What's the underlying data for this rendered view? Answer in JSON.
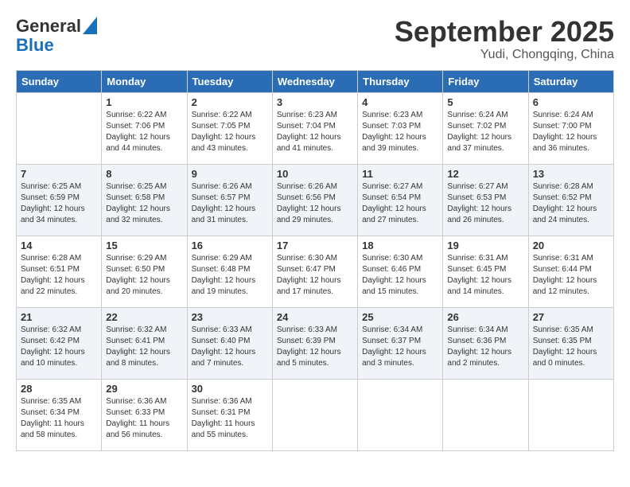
{
  "header": {
    "logo_line1": "General",
    "logo_line2": "Blue",
    "month": "September 2025",
    "location": "Yudi, Chongqing, China"
  },
  "weekdays": [
    "Sunday",
    "Monday",
    "Tuesday",
    "Wednesday",
    "Thursday",
    "Friday",
    "Saturday"
  ],
  "weeks": [
    [
      {
        "day": "",
        "sunrise": "",
        "sunset": "",
        "daylight": ""
      },
      {
        "day": "1",
        "sunrise": "6:22 AM",
        "sunset": "7:06 PM",
        "daylight": "12 hours and 44 minutes."
      },
      {
        "day": "2",
        "sunrise": "6:22 AM",
        "sunset": "7:05 PM",
        "daylight": "12 hours and 43 minutes."
      },
      {
        "day": "3",
        "sunrise": "6:23 AM",
        "sunset": "7:04 PM",
        "daylight": "12 hours and 41 minutes."
      },
      {
        "day": "4",
        "sunrise": "6:23 AM",
        "sunset": "7:03 PM",
        "daylight": "12 hours and 39 minutes."
      },
      {
        "day": "5",
        "sunrise": "6:24 AM",
        "sunset": "7:02 PM",
        "daylight": "12 hours and 37 minutes."
      },
      {
        "day": "6",
        "sunrise": "6:24 AM",
        "sunset": "7:00 PM",
        "daylight": "12 hours and 36 minutes."
      }
    ],
    [
      {
        "day": "7",
        "sunrise": "6:25 AM",
        "sunset": "6:59 PM",
        "daylight": "12 hours and 34 minutes."
      },
      {
        "day": "8",
        "sunrise": "6:25 AM",
        "sunset": "6:58 PM",
        "daylight": "12 hours and 32 minutes."
      },
      {
        "day": "9",
        "sunrise": "6:26 AM",
        "sunset": "6:57 PM",
        "daylight": "12 hours and 31 minutes."
      },
      {
        "day": "10",
        "sunrise": "6:26 AM",
        "sunset": "6:56 PM",
        "daylight": "12 hours and 29 minutes."
      },
      {
        "day": "11",
        "sunrise": "6:27 AM",
        "sunset": "6:54 PM",
        "daylight": "12 hours and 27 minutes."
      },
      {
        "day": "12",
        "sunrise": "6:27 AM",
        "sunset": "6:53 PM",
        "daylight": "12 hours and 26 minutes."
      },
      {
        "day": "13",
        "sunrise": "6:28 AM",
        "sunset": "6:52 PM",
        "daylight": "12 hours and 24 minutes."
      }
    ],
    [
      {
        "day": "14",
        "sunrise": "6:28 AM",
        "sunset": "6:51 PM",
        "daylight": "12 hours and 22 minutes."
      },
      {
        "day": "15",
        "sunrise": "6:29 AM",
        "sunset": "6:50 PM",
        "daylight": "12 hours and 20 minutes."
      },
      {
        "day": "16",
        "sunrise": "6:29 AM",
        "sunset": "6:48 PM",
        "daylight": "12 hours and 19 minutes."
      },
      {
        "day": "17",
        "sunrise": "6:30 AM",
        "sunset": "6:47 PM",
        "daylight": "12 hours and 17 minutes."
      },
      {
        "day": "18",
        "sunrise": "6:30 AM",
        "sunset": "6:46 PM",
        "daylight": "12 hours and 15 minutes."
      },
      {
        "day": "19",
        "sunrise": "6:31 AM",
        "sunset": "6:45 PM",
        "daylight": "12 hours and 14 minutes."
      },
      {
        "day": "20",
        "sunrise": "6:31 AM",
        "sunset": "6:44 PM",
        "daylight": "12 hours and 12 minutes."
      }
    ],
    [
      {
        "day": "21",
        "sunrise": "6:32 AM",
        "sunset": "6:42 PM",
        "daylight": "12 hours and 10 minutes."
      },
      {
        "day": "22",
        "sunrise": "6:32 AM",
        "sunset": "6:41 PM",
        "daylight": "12 hours and 8 minutes."
      },
      {
        "day": "23",
        "sunrise": "6:33 AM",
        "sunset": "6:40 PM",
        "daylight": "12 hours and 7 minutes."
      },
      {
        "day": "24",
        "sunrise": "6:33 AM",
        "sunset": "6:39 PM",
        "daylight": "12 hours and 5 minutes."
      },
      {
        "day": "25",
        "sunrise": "6:34 AM",
        "sunset": "6:37 PM",
        "daylight": "12 hours and 3 minutes."
      },
      {
        "day": "26",
        "sunrise": "6:34 AM",
        "sunset": "6:36 PM",
        "daylight": "12 hours and 2 minutes."
      },
      {
        "day": "27",
        "sunrise": "6:35 AM",
        "sunset": "6:35 PM",
        "daylight": "12 hours and 0 minutes."
      }
    ],
    [
      {
        "day": "28",
        "sunrise": "6:35 AM",
        "sunset": "6:34 PM",
        "daylight": "11 hours and 58 minutes."
      },
      {
        "day": "29",
        "sunrise": "6:36 AM",
        "sunset": "6:33 PM",
        "daylight": "11 hours and 56 minutes."
      },
      {
        "day": "30",
        "sunrise": "6:36 AM",
        "sunset": "6:31 PM",
        "daylight": "11 hours and 55 minutes."
      },
      {
        "day": "",
        "sunrise": "",
        "sunset": "",
        "daylight": ""
      },
      {
        "day": "",
        "sunrise": "",
        "sunset": "",
        "daylight": ""
      },
      {
        "day": "",
        "sunrise": "",
        "sunset": "",
        "daylight": ""
      },
      {
        "day": "",
        "sunrise": "",
        "sunset": "",
        "daylight": ""
      }
    ]
  ]
}
